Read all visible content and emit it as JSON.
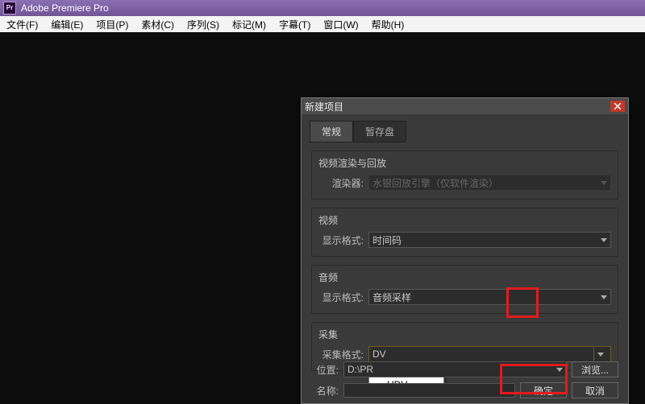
{
  "app_title": "Adobe Premiere Pro",
  "menu": [
    "文件(F)",
    "编辑(E)",
    "项目(P)",
    "素材(C)",
    "序列(S)",
    "标记(M)",
    "字幕(T)",
    "窗口(W)",
    "帮助(H)"
  ],
  "dialog": {
    "title": "新建项目",
    "tabs": {
      "general": "常规",
      "scratch": "暂存盘"
    },
    "groups": {
      "render": {
        "title": "视频渲染与回放",
        "renderer_label": "渲染器:",
        "renderer_value": "水银回放引擎（仅软件渲染）"
      },
      "video": {
        "title": "视频",
        "format_label": "显示格式:",
        "format_value": "时间码"
      },
      "audio": {
        "title": "音频",
        "format_label": "显示格式:",
        "format_value": "音频采样"
      },
      "capture": {
        "title": "采集",
        "format_label": "采集格式:",
        "format_value": "DV",
        "options": [
          "DV",
          "HDV"
        ]
      }
    },
    "location_label": "位置:",
    "location_value": "D:\\PR",
    "browse": "浏览...",
    "name_label": "名称:",
    "name_value": "",
    "ok": "确定",
    "cancel": "取消"
  }
}
